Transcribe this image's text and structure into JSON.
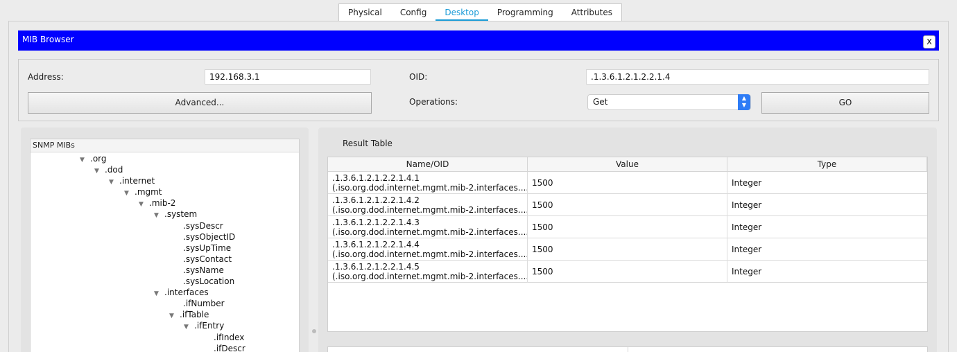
{
  "tabs": [
    "Physical",
    "Config",
    "Desktop",
    "Programming",
    "Attributes"
  ],
  "active_tab": "Desktop",
  "window": {
    "title": "MIB Browser",
    "close_label": "X"
  },
  "form": {
    "address_label": "Address:",
    "address_value": "192.168.3.1",
    "advanced_label": "Advanced...",
    "oid_label": "OID:",
    "oid_value": ".1.3.6.1.2.1.2.2.1.4",
    "operations_label": "Operations:",
    "operation_value": "Get",
    "go_label": "GO"
  },
  "tree": {
    "header": "SNMP MIBs",
    "nodes": [
      {
        "label": ".org",
        "expanded": true
      },
      {
        "label": ".dod",
        "expanded": true
      },
      {
        "label": ".internet",
        "expanded": true
      },
      {
        "label": ".mgmt",
        "expanded": true
      },
      {
        "label": ".mib-2",
        "expanded": true
      },
      {
        "label": ".system",
        "expanded": true
      },
      {
        "label": ".sysDescr",
        "expanded": false
      },
      {
        "label": ".sysObjectID",
        "expanded": false
      },
      {
        "label": ".sysUpTime",
        "expanded": false
      },
      {
        "label": ".sysContact",
        "expanded": false
      },
      {
        "label": ".sysName",
        "expanded": false
      },
      {
        "label": ".sysLocation",
        "expanded": false
      },
      {
        "label": ".interfaces",
        "expanded": true
      },
      {
        "label": ".ifNumber",
        "expanded": false
      },
      {
        "label": ".ifTable",
        "expanded": true
      },
      {
        "label": ".ifEntry",
        "expanded": true
      },
      {
        "label": ".ifIndex",
        "expanded": false
      },
      {
        "label": ".ifDescr",
        "expanded": false
      }
    ]
  },
  "result": {
    "title": "Result Table",
    "columns": [
      "Name/OID",
      "Value",
      "Type"
    ],
    "rows": [
      {
        "oid": ".1.3.6.1.2.1.2.2.1.4.1",
        "name": "(.iso.org.dod.internet.mgmt.mib-2.interfaces....",
        "value": "1500",
        "type": "Integer"
      },
      {
        "oid": ".1.3.6.1.2.1.2.2.1.4.2",
        "name": "(.iso.org.dod.internet.mgmt.mib-2.interfaces....",
        "value": "1500",
        "type": "Integer"
      },
      {
        "oid": ".1.3.6.1.2.1.2.2.1.4.3",
        "name": "(.iso.org.dod.internet.mgmt.mib-2.interfaces....",
        "value": "1500",
        "type": "Integer"
      },
      {
        "oid": ".1.3.6.1.2.1.2.2.1.4.4",
        "name": "(.iso.org.dod.internet.mgmt.mib-2.interfaces....",
        "value": "1500",
        "type": "Integer"
      },
      {
        "oid": ".1.3.6.1.2.1.2.2.1.4.5",
        "name": "(.iso.org.dod.internet.mgmt.mib-2.interfaces....",
        "value": "1500",
        "type": "Integer"
      }
    ]
  },
  "colors": {
    "titlebar": "#0000ff",
    "active_tab": "#1a9bd7",
    "select_accent": "#2e7cf6"
  },
  "icons": {
    "expanded": "triangle-down-icon",
    "select": "up-down-arrows-icon"
  }
}
